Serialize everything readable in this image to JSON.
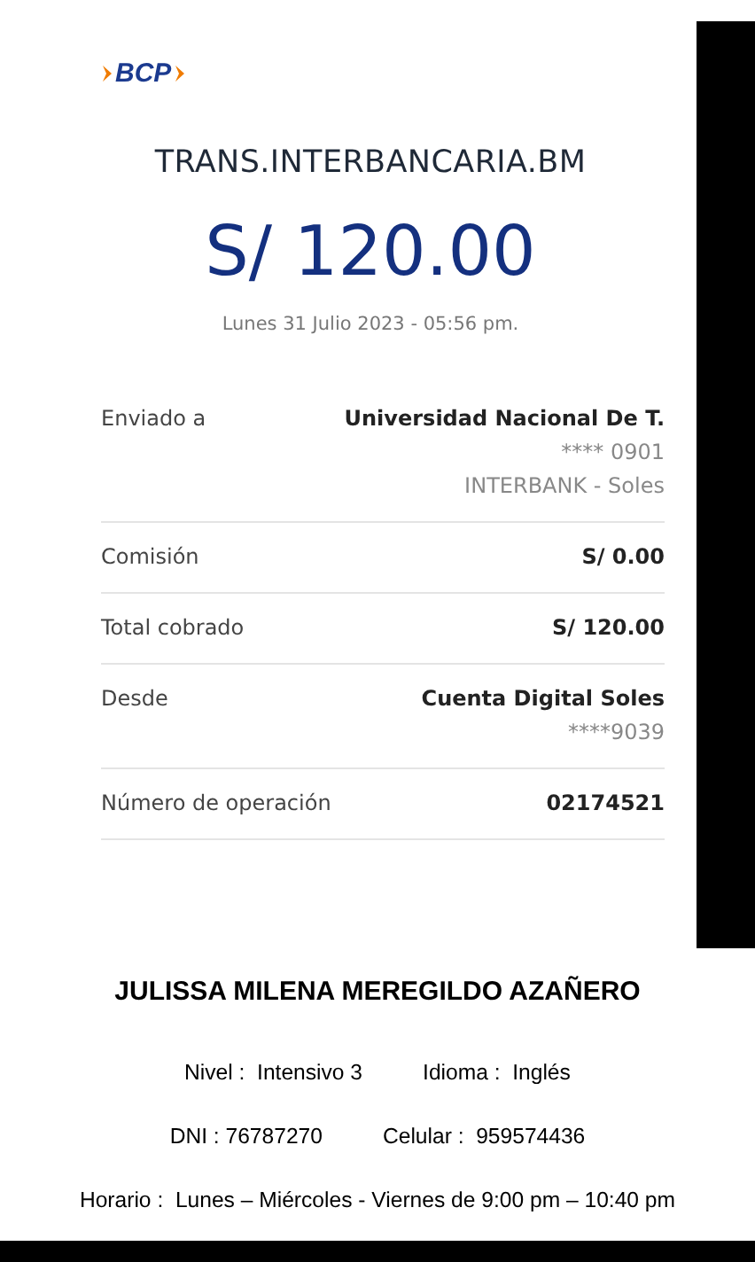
{
  "receipt": {
    "logo": "BCP",
    "title": "TRANS.INTERBANCARIA.BM",
    "amount": "S/ 120.00",
    "date": "Lunes 31 Julio 2023 - 05:56 pm.",
    "rows": [
      {
        "label": "Enviado a",
        "values": [
          {
            "text": "Universidad Nacional De T.",
            "kind": "primary"
          },
          {
            "text": "**** 0901",
            "kind": "secondary"
          },
          {
            "text": "INTERBANK - Soles",
            "kind": "secondary"
          }
        ]
      },
      {
        "label": "Comisión",
        "values": [
          {
            "text": "S/ 0.00",
            "kind": "primary"
          }
        ]
      },
      {
        "label": "Total cobrado",
        "values": [
          {
            "text": "S/ 120.00",
            "kind": "primary"
          }
        ]
      },
      {
        "label": "Desde",
        "values": [
          {
            "text": "Cuenta Digital Soles",
            "kind": "primary"
          },
          {
            "text": "****9039",
            "kind": "secondary"
          }
        ]
      },
      {
        "label": "Número de operación",
        "values": [
          {
            "text": "02174521",
            "kind": "primary"
          }
        ]
      }
    ]
  },
  "student": {
    "name": "JULISSA MILENA MEREGILDO AZAÑERO",
    "lines": [
      [
        "Nivel :  Intensivo 3",
        "Idioma :  Inglés"
      ],
      [
        "DNI : 76787270",
        "Celular :  959574436"
      ],
      [
        "Horario :  Lunes – Miércoles - Viernes de 9:00 pm – 10:40 pm"
      ]
    ]
  }
}
